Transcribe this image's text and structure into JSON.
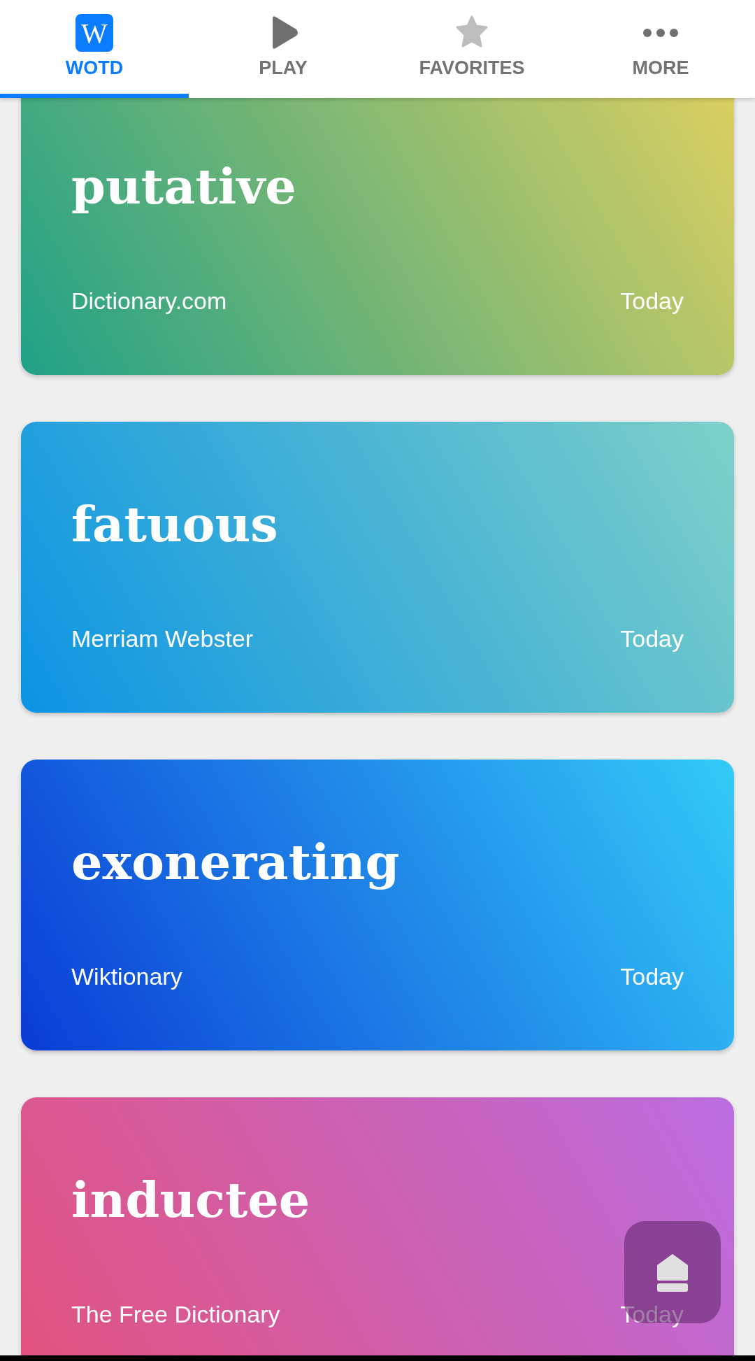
{
  "tabs": [
    {
      "label": "WOTD",
      "kind": "logo",
      "icon_text": "W",
      "selected": true
    },
    {
      "label": "PLAY",
      "kind": "play",
      "selected": false
    },
    {
      "label": "FAVORITES",
      "kind": "star",
      "selected": false
    },
    {
      "label": "MORE",
      "kind": "more",
      "selected": false
    }
  ],
  "cards": [
    {
      "word": "putative",
      "source": "Dictionary.com",
      "date": "Today",
      "kind": "meadow"
    },
    {
      "word": "fatuous",
      "source": "Merriam Webster",
      "date": "Today",
      "kind": "sky"
    },
    {
      "word": "exonerating",
      "source": "Wiktionary",
      "date": "Today",
      "kind": "ocean"
    },
    {
      "word": "inductee",
      "source": "The Free Dictionary",
      "date": "Today",
      "kind": "orchid"
    }
  ]
}
